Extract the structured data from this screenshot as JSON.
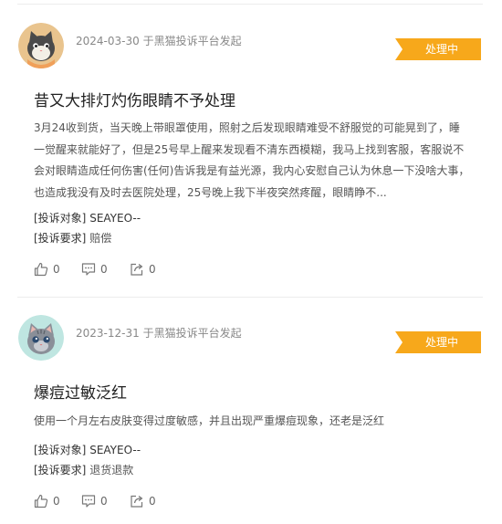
{
  "posts": [
    {
      "date": "2024-03-30",
      "source": "于黑猫投诉平台发起",
      "status": "处理中",
      "title": "昔又大排灯灼伤眼睛不予处理",
      "body": "3月24收到货，当天晚上带眼罩使用，照射之后发现眼睛难受不舒服觉的可能晃到了，睡一觉醒来就能好了，但是25号早上醒来发现看不清东西模糊，我马上找到客服，客服说不会对眼睛造成任何伤害(任何)告诉我是有益光源，我内心安慰自己认为休息一下没啥大事，也造成我没有及时去医院处理，25号晚上我下半夜突然疼醒，眼睛睁不...",
      "target_label": "[投诉对象]",
      "target_value": "SEAYEO--",
      "request_label": "[投诉要求]",
      "request_value": "赔偿",
      "likes": "0",
      "comments": "0",
      "shares": "0"
    },
    {
      "date": "2023-12-31",
      "source": "于黑猫投诉平台发起",
      "status": "处理中",
      "title": "爆痘过敏泛红",
      "body": "使用一个月左右皮肤变得过度敏感，并且出现严重爆痘现象，还老是泛红",
      "target_label": "[投诉对象]",
      "target_value": "SEAYEO--",
      "request_label": "[投诉要求]",
      "request_value": "退货退款",
      "likes": "0",
      "comments": "0",
      "shares": "0"
    }
  ],
  "colors": {
    "badge": "#f7a81b",
    "avatar1_bg": "#e9c48e",
    "avatar2_bg": "#bfe6e1"
  },
  "icons": [
    "cat-avatar-icon",
    "thumbs-up-icon",
    "comment-icon",
    "share-icon"
  ]
}
